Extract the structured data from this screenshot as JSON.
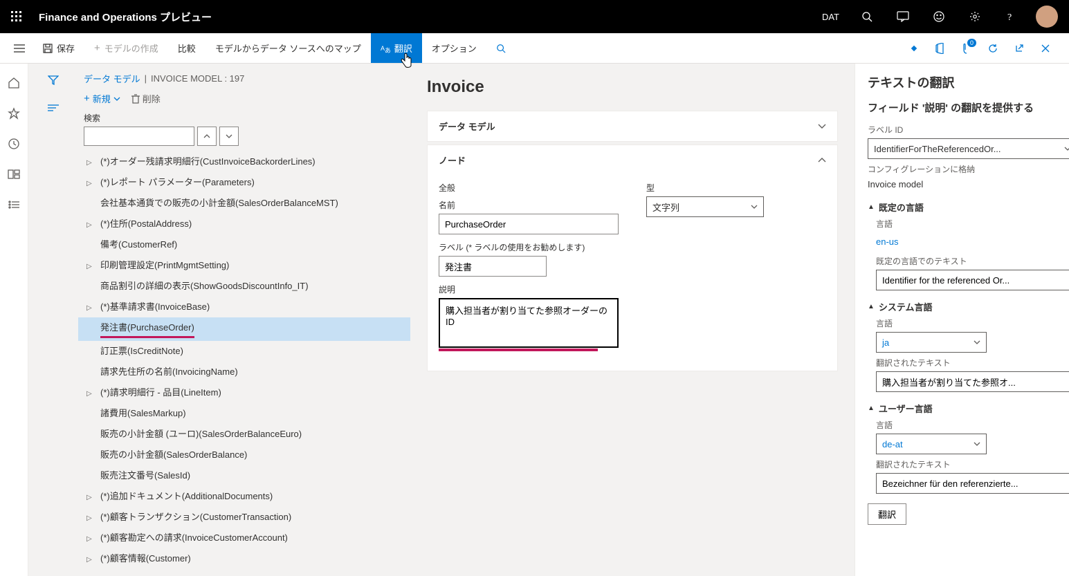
{
  "header": {
    "app_title": "Finance and Operations プレビュー",
    "company": "DAT"
  },
  "commandbar": {
    "save": "保存",
    "create_model": "モデルの作成",
    "compare": "比較",
    "map_ds": "モデルからデータ ソースへのマップ",
    "translate": "翻訳",
    "option": "オプション",
    "badge": "0"
  },
  "breadcrumb": {
    "root": "データ モデル",
    "current": "INVOICE MODEL : 197"
  },
  "tree_toolbar": {
    "new": "新規",
    "delete": "削除"
  },
  "search_label": "検索",
  "tree": {
    "items": [
      {
        "chev": true,
        "label": "(*)オーダー残請求明細行(CustInvoiceBackorderLines)"
      },
      {
        "chev": true,
        "label": "(*)レポート パラメーター(Parameters)"
      },
      {
        "chev": false,
        "label": "会社基本通貨での販売の小計金額(SalesOrderBalanceMST)"
      },
      {
        "chev": true,
        "label": "(*)住所(PostalAddress)"
      },
      {
        "chev": false,
        "label": "備考(CustomerRef)"
      },
      {
        "chev": true,
        "label": "印刷管理設定(PrintMgmtSetting)"
      },
      {
        "chev": false,
        "label": "商品割引の詳細の表示(ShowGoodsDiscountInfo_IT)"
      },
      {
        "chev": true,
        "label": "(*)基準請求書(InvoiceBase)"
      },
      {
        "chev": false,
        "label": "発注書(PurchaseOrder)",
        "selected": true
      },
      {
        "chev": false,
        "label": "訂正票(IsCreditNote)"
      },
      {
        "chev": false,
        "label": "請求先住所の名前(InvoicingName)"
      },
      {
        "chev": true,
        "label": "(*)請求明細行 - 品目(LineItem)"
      },
      {
        "chev": false,
        "label": "諸費用(SalesMarkup)"
      },
      {
        "chev": false,
        "label": "販売の小計金額 (ユーロ)(SalesOrderBalanceEuro)"
      },
      {
        "chev": false,
        "label": "販売の小計金額(SalesOrderBalance)"
      },
      {
        "chev": false,
        "label": "販売注文番号(SalesId)"
      },
      {
        "chev": true,
        "label": "(*)追加ドキュメント(AdditionalDocuments)"
      },
      {
        "chev": true,
        "label": "(*)顧客トランザクション(CustomerTransaction)"
      },
      {
        "chev": true,
        "label": "(*)顧客勘定への請求(InvoiceCustomerAccount)"
      },
      {
        "chev": true,
        "label": "(*)顧客情報(Customer)"
      }
    ]
  },
  "detail": {
    "heading": "Invoice",
    "card1": "データ モデル",
    "card2": "ノード",
    "general": "全般",
    "name_lbl": "名前",
    "name_val": "PurchaseOrder",
    "label_lbl": "ラベル (* ラベルの使用をお勧めします)",
    "label_val": "発注書",
    "desc_lbl": "説明",
    "desc_val": "購入担当者が割り当てた参照オーダーの ID",
    "type_lbl": "型",
    "type_val": "文字列"
  },
  "sidepanel": {
    "title": "テキストの翻訳",
    "subtitle": "フィールド '説明' の翻訳を提供する",
    "labelid_lbl": "ラベル ID",
    "labelid_val": "IdentifierForTheReferencedOr...",
    "stored_lbl": "コンフィグレーションに格納",
    "stored_val": "Invoice model",
    "default_lang_section": "既定の言語",
    "lang_lbl": "言語",
    "default_lang_val": "en-us",
    "default_text_lbl": "既定の言語でのテキスト",
    "default_text_val": "Identifier for the referenced Or...",
    "system_lang_section": "システム言語",
    "system_lang_val": "ja",
    "translated_lbl": "翻訳されたテキスト",
    "system_translated_val": "購入担当者が割り当てた参照オ...",
    "user_lang_section": "ユーザー言語",
    "user_lang_val": "de-at",
    "user_translated_val": "Bezeichner für den referenzierte...",
    "translate_btn": "翻訳"
  }
}
